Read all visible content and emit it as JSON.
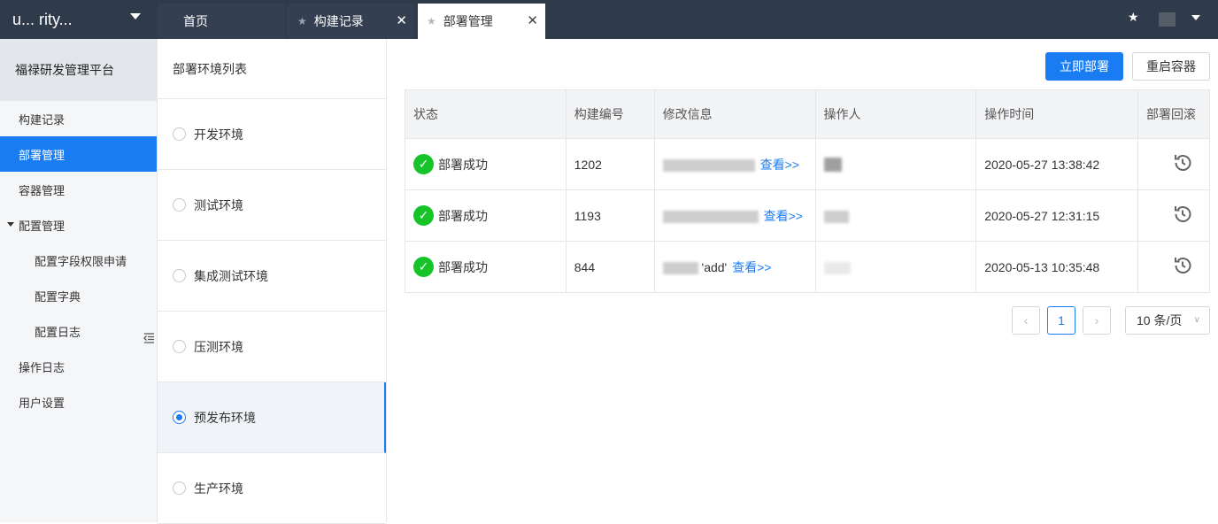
{
  "topbar": {
    "project": "u... rity...",
    "tabs": [
      {
        "label": "首页"
      },
      {
        "label": "构建记录",
        "close": "✕"
      },
      {
        "label": "部署管理",
        "close": "✕"
      }
    ]
  },
  "sidebar": {
    "title": "福禄研发管理平台",
    "items": [
      {
        "label": "构建记录"
      },
      {
        "label": "部署管理"
      },
      {
        "label": "容器管理"
      },
      {
        "label": "配置管理"
      },
      {
        "label": "配置字段权限申请"
      },
      {
        "label": "配置字典"
      },
      {
        "label": "配置日志"
      },
      {
        "label": "操作日志"
      },
      {
        "label": "用户设置"
      }
    ]
  },
  "env": {
    "title": "部署环境列表",
    "items": [
      "开发环境",
      "测试环境",
      "集成测试环境",
      "压测环境",
      "预发布环境",
      "生产环境"
    ],
    "selected": "预发布环境"
  },
  "actions": {
    "deploy": "立即部署",
    "restart": "重启容器"
  },
  "table": {
    "headers": [
      "状态",
      "构建编号",
      "修改信息",
      "操作人",
      "操作时间",
      "部署回滚"
    ],
    "rows": [
      {
        "status": "部署成功",
        "build": "1202",
        "info": "",
        "link": "查看>>",
        "time": "2020-05-27 13:38:42"
      },
      {
        "status": "部署成功",
        "build": "1193",
        "info": "",
        "link": "查看>>",
        "time": "2020-05-27 12:31:15"
      },
      {
        "status": "部署成功",
        "build": "844",
        "info": "'add'",
        "link": "查看>>",
        "time": "2020-05-13 10:35:48"
      }
    ]
  },
  "pagination": {
    "prev": "‹",
    "page": "1",
    "next": "›",
    "size": "10 条/页"
  },
  "colors": {
    "primary": "#1a7cf2",
    "success": "#16c42a",
    "topbar": "#2f3a4b"
  }
}
